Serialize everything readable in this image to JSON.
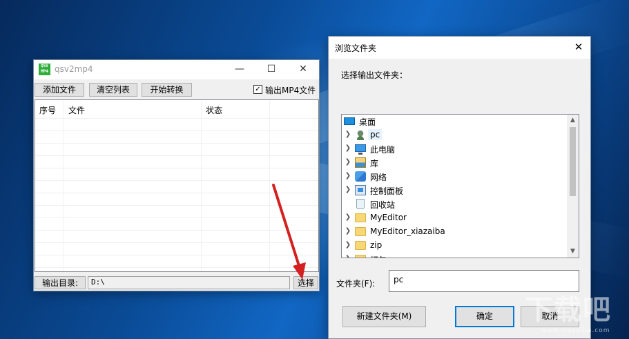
{
  "app": {
    "logo_text_top": "QSV",
    "logo_text_bottom": "MP4",
    "title": "qsv2mp4",
    "minimize_glyph": "—",
    "maximize_glyph": "☐",
    "close_glyph": "✕",
    "toolbar": {
      "add_file": "添加文件",
      "clear_list": "清空列表",
      "start_convert": "开始转换",
      "output_mp4_checked": true,
      "output_mp4_label": "输出MP4文件"
    },
    "columns": [
      "序号",
      "文件",
      "状态"
    ],
    "output_dir_label": "输出目录:",
    "output_dir_value": "D:\\",
    "select_button": "选择"
  },
  "dialog": {
    "title": "浏览文件夹",
    "close_glyph": "✕",
    "prompt": "选择输出文件夹：",
    "tree": [
      {
        "label": "桌面",
        "icon": "desktop-icon",
        "expandable": false,
        "indent": 0,
        "selected": false
      },
      {
        "label": "pc",
        "icon": "user-icon",
        "expandable": true,
        "indent": 1,
        "selected": true
      },
      {
        "label": "此电脑",
        "icon": "computer-icon",
        "expandable": true,
        "indent": 1,
        "selected": false
      },
      {
        "label": "库",
        "icon": "library-icon",
        "expandable": true,
        "indent": 1,
        "selected": false
      },
      {
        "label": "网络",
        "icon": "network-icon",
        "expandable": true,
        "indent": 1,
        "selected": false
      },
      {
        "label": "控制面板",
        "icon": "control-panel-icon",
        "expandable": true,
        "indent": 1,
        "selected": false
      },
      {
        "label": "回收站",
        "icon": "recycle-bin-icon",
        "expandable": false,
        "indent": 1,
        "selected": false
      },
      {
        "label": "MyEditor",
        "icon": "folder-icon",
        "expandable": true,
        "indent": 1,
        "selected": false
      },
      {
        "label": "MyEditor_xiazaiba",
        "icon": "folder-icon",
        "expandable": true,
        "indent": 1,
        "selected": false
      },
      {
        "label": "zip",
        "icon": "folder-icon",
        "expandable": true,
        "indent": 1,
        "selected": false
      },
      {
        "label": "打包",
        "icon": "folder-icon",
        "expandable": true,
        "indent": 1,
        "selected": false
      }
    ],
    "folder_label": "文件夹(F):",
    "folder_value": "pc",
    "new_folder_button": "新建文件夹(M)",
    "ok_button": "确定",
    "cancel_button": "取消"
  },
  "watermark": {
    "text": "下载吧",
    "url": "www.xiazaiba.com"
  },
  "colors": {
    "annotation_arrow": "#d42020",
    "selection": "#e5f3ff",
    "focus_border": "#0078d7"
  }
}
